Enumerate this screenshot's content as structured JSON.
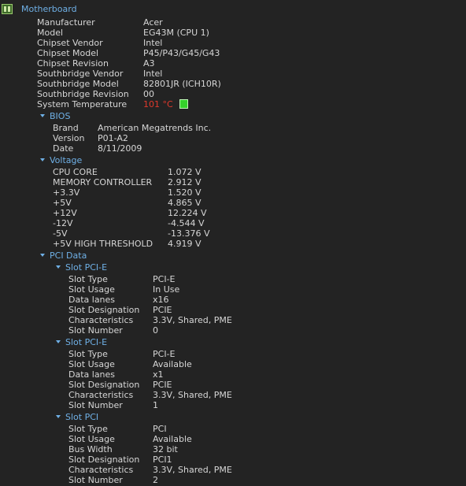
{
  "title": "Motherboard",
  "main": [
    {
      "label": "Manufacturer",
      "value": "Acer"
    },
    {
      "label": "Model",
      "value": "EG43M (CPU 1)"
    },
    {
      "label": "Chipset Vendor",
      "value": "Intel"
    },
    {
      "label": "Chipset Model",
      "value": "P45/P43/G45/G43"
    },
    {
      "label": "Chipset Revision",
      "value": "A3"
    },
    {
      "label": "Southbridge Vendor",
      "value": "Intel"
    },
    {
      "label": "Southbridge Model",
      "value": "82801JR (ICH10R)"
    },
    {
      "label": "Southbridge Revision",
      "value": "00"
    }
  ],
  "temperature": {
    "label": "System Temperature",
    "value": "101 °C",
    "indicator_color": "#35d12b",
    "value_color": "#e0392c"
  },
  "bios": {
    "title": "BIOS",
    "items": [
      {
        "label": "Brand",
        "value": "American Megatrends Inc."
      },
      {
        "label": "Version",
        "value": "P01-A2"
      },
      {
        "label": "Date",
        "value": "8/11/2009"
      }
    ]
  },
  "voltage": {
    "title": "Voltage",
    "items": [
      {
        "label": "CPU CORE",
        "value": "1.072 V"
      },
      {
        "label": "MEMORY CONTROLLER",
        "value": "2.912 V"
      },
      {
        "label": "+3.3V",
        "value": "1.520 V"
      },
      {
        "label": "+5V",
        "value": "4.865 V"
      },
      {
        "label": "+12V",
        "value": "12.224 V"
      },
      {
        "label": "-12V",
        "value": "-4.544 V"
      },
      {
        "label": "-5V",
        "value": "-13.376 V"
      },
      {
        "label": "+5V HIGH THRESHOLD",
        "value": "4.919 V"
      }
    ]
  },
  "pci": {
    "title": "PCI Data",
    "slots": [
      {
        "title": "Slot PCI-E",
        "items": [
          {
            "label": "Slot Type",
            "value": "PCI-E"
          },
          {
            "label": "Slot Usage",
            "value": "In Use"
          },
          {
            "label": "Data lanes",
            "value": "x16"
          },
          {
            "label": "Slot Designation",
            "value": "PCIE"
          },
          {
            "label": "Characteristics",
            "value": "3.3V, Shared, PME"
          },
          {
            "label": "Slot Number",
            "value": "0"
          }
        ]
      },
      {
        "title": "Slot PCI-E",
        "items": [
          {
            "label": "Slot Type",
            "value": "PCI-E"
          },
          {
            "label": "Slot Usage",
            "value": "Available"
          },
          {
            "label": "Data lanes",
            "value": "x1"
          },
          {
            "label": "Slot Designation",
            "value": "PCIE"
          },
          {
            "label": "Characteristics",
            "value": "3.3V, Shared, PME"
          },
          {
            "label": "Slot Number",
            "value": "1"
          }
        ]
      },
      {
        "title": "Slot PCI",
        "items": [
          {
            "label": "Slot Type",
            "value": "PCI"
          },
          {
            "label": "Slot Usage",
            "value": "Available"
          },
          {
            "label": "Bus Width",
            "value": "32 bit"
          },
          {
            "label": "Slot Designation",
            "value": "PCI1"
          },
          {
            "label": "Characteristics",
            "value": "3.3V, Shared, PME"
          },
          {
            "label": "Slot Number",
            "value": "2"
          }
        ]
      }
    ]
  }
}
